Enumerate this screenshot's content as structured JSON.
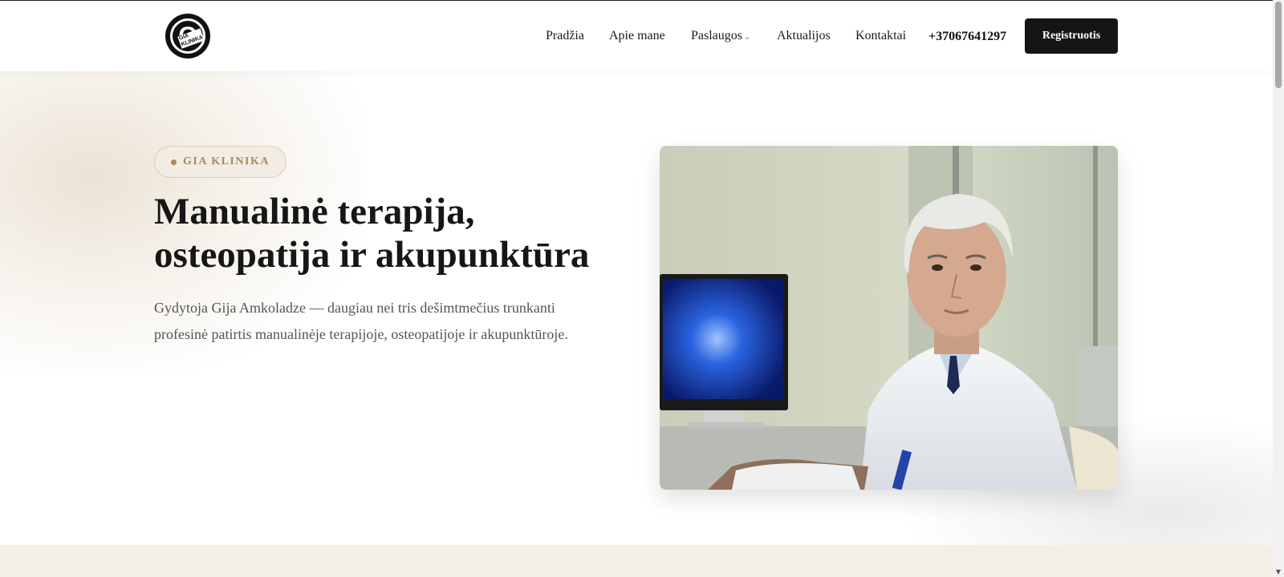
{
  "header": {
    "nav": [
      {
        "label": "Pradžia"
      },
      {
        "label": "Apie mane"
      },
      {
        "label": "Paslaugos",
        "icon": "chevron-down-icon"
      },
      {
        "label": "Aktualijos"
      },
      {
        "label": "Kontaktai"
      }
    ],
    "phone": "+37067641297",
    "register_label": "Registruotis",
    "logo_text": "GIA KLINIKA"
  },
  "hero": {
    "badge": "GIA KLINIKA",
    "title": "Manualinė terapija, osteopatija ir akupunktūra",
    "lead": "Gydytoja Gija Amkoladze — daugiau nei tris dešimtmečius trunkanti profesinė patirtis manualinėje terapijoje, osteopatijoje ir akupunktūroje.",
    "image": "doctor-portrait"
  },
  "colors": {
    "accent": "#a88a5e",
    "button_bg": "#151515",
    "badge_bg": "#f3ece2",
    "band_bg": "#f3efe6"
  }
}
